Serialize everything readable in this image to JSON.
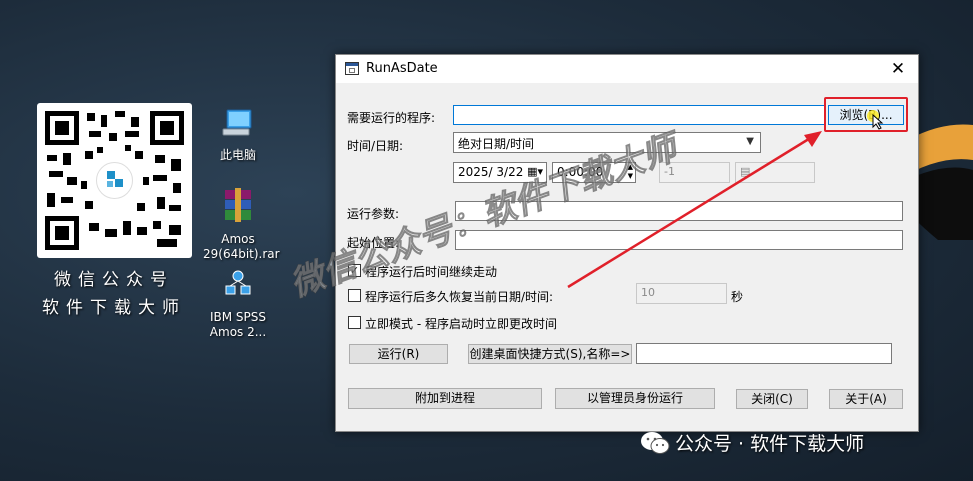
{
  "desktop": {
    "qr_caption_line1": "微信公众号",
    "qr_caption_line2": "软件下载大师",
    "icons": [
      {
        "label": "此电脑",
        "icon": "computer-icon"
      },
      {
        "label": "Amos\n29(64bit).rar",
        "icon": "winrar-archive-icon"
      },
      {
        "label": "IBM SPSS\nAmos 2...",
        "icon": "spss-amos-icon"
      }
    ]
  },
  "window": {
    "title": "RunAsDate",
    "close_glyph": "✕",
    "program_label": "需要运行的程序:",
    "program_value": "",
    "browse_label": "浏览(B)...",
    "datetime_label": "时间/日期:",
    "datetime_mode": "绝对日期/时间",
    "date_value": "2025/ 3/22",
    "time_value": "0:00:00",
    "offset_value": "-1",
    "params_label": "运行参数:",
    "params_value": "",
    "startdir_label": "起始位置:",
    "startdir_value": "",
    "chk_continue_label": "程序运行后时间继续走动",
    "chk_continue_checked": true,
    "chk_restore_label": "程序运行后多久恢复当前日期/时间:",
    "chk_restore_checked": false,
    "restore_seconds": "10",
    "seconds_unit": "秒",
    "chk_immediate_label": "立即模式 - 程序启动时立即更改时间",
    "chk_immediate_checked": false,
    "run_label": "运行(R)",
    "shortcut_label": "创建桌面快捷方式(S),名称=>",
    "shortcut_name": "",
    "attach_label": "附加到进程",
    "admin_label": "以管理员身份运行",
    "close_label": "关闭(C)",
    "about_label": "关于(A)"
  },
  "watermark": {
    "diagonal": "微信公众号：软件下载大师",
    "footer": "公众号 · 软件下载大师"
  },
  "colors": {
    "highlight": "#e0202a",
    "arrow": "#e0202a",
    "accent": "#0078d7"
  }
}
